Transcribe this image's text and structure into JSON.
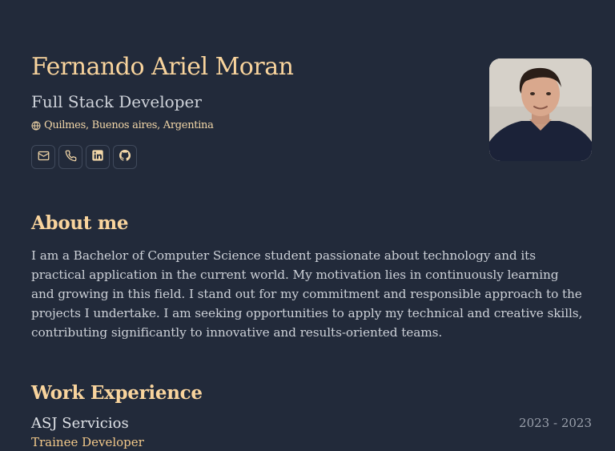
{
  "header": {
    "name": "Fernando Ariel Moran",
    "role": "Full Stack Developer",
    "location": "Quilmes, Buenos aires, Argentina",
    "location_icon": "globe-icon",
    "socials": [
      {
        "icon": "mail-icon"
      },
      {
        "icon": "phone-icon"
      },
      {
        "icon": "linkedin-icon"
      },
      {
        "icon": "github-icon"
      }
    ]
  },
  "about": {
    "title": "About me",
    "text": "I am a Bachelor of Computer Science student passionate about technology and its practical application in the current world. My motivation lies in continuously learning and growing in this field. I stand out for my commitment and responsible approach to the projects I undertake. I am seeking opportunities to apply my technical and creative skills, contributing significantly to innovative and results-oriented teams."
  },
  "work": {
    "title": "Work Experience",
    "items": [
      {
        "company": "ASJ Servicios",
        "dates": "2023 - 2023",
        "role": "Trainee Developer"
      }
    ]
  },
  "colors": {
    "background": "#222a3a",
    "accent": "#f9d49d",
    "text": "#cdd1d8",
    "border": "#404a5c"
  }
}
